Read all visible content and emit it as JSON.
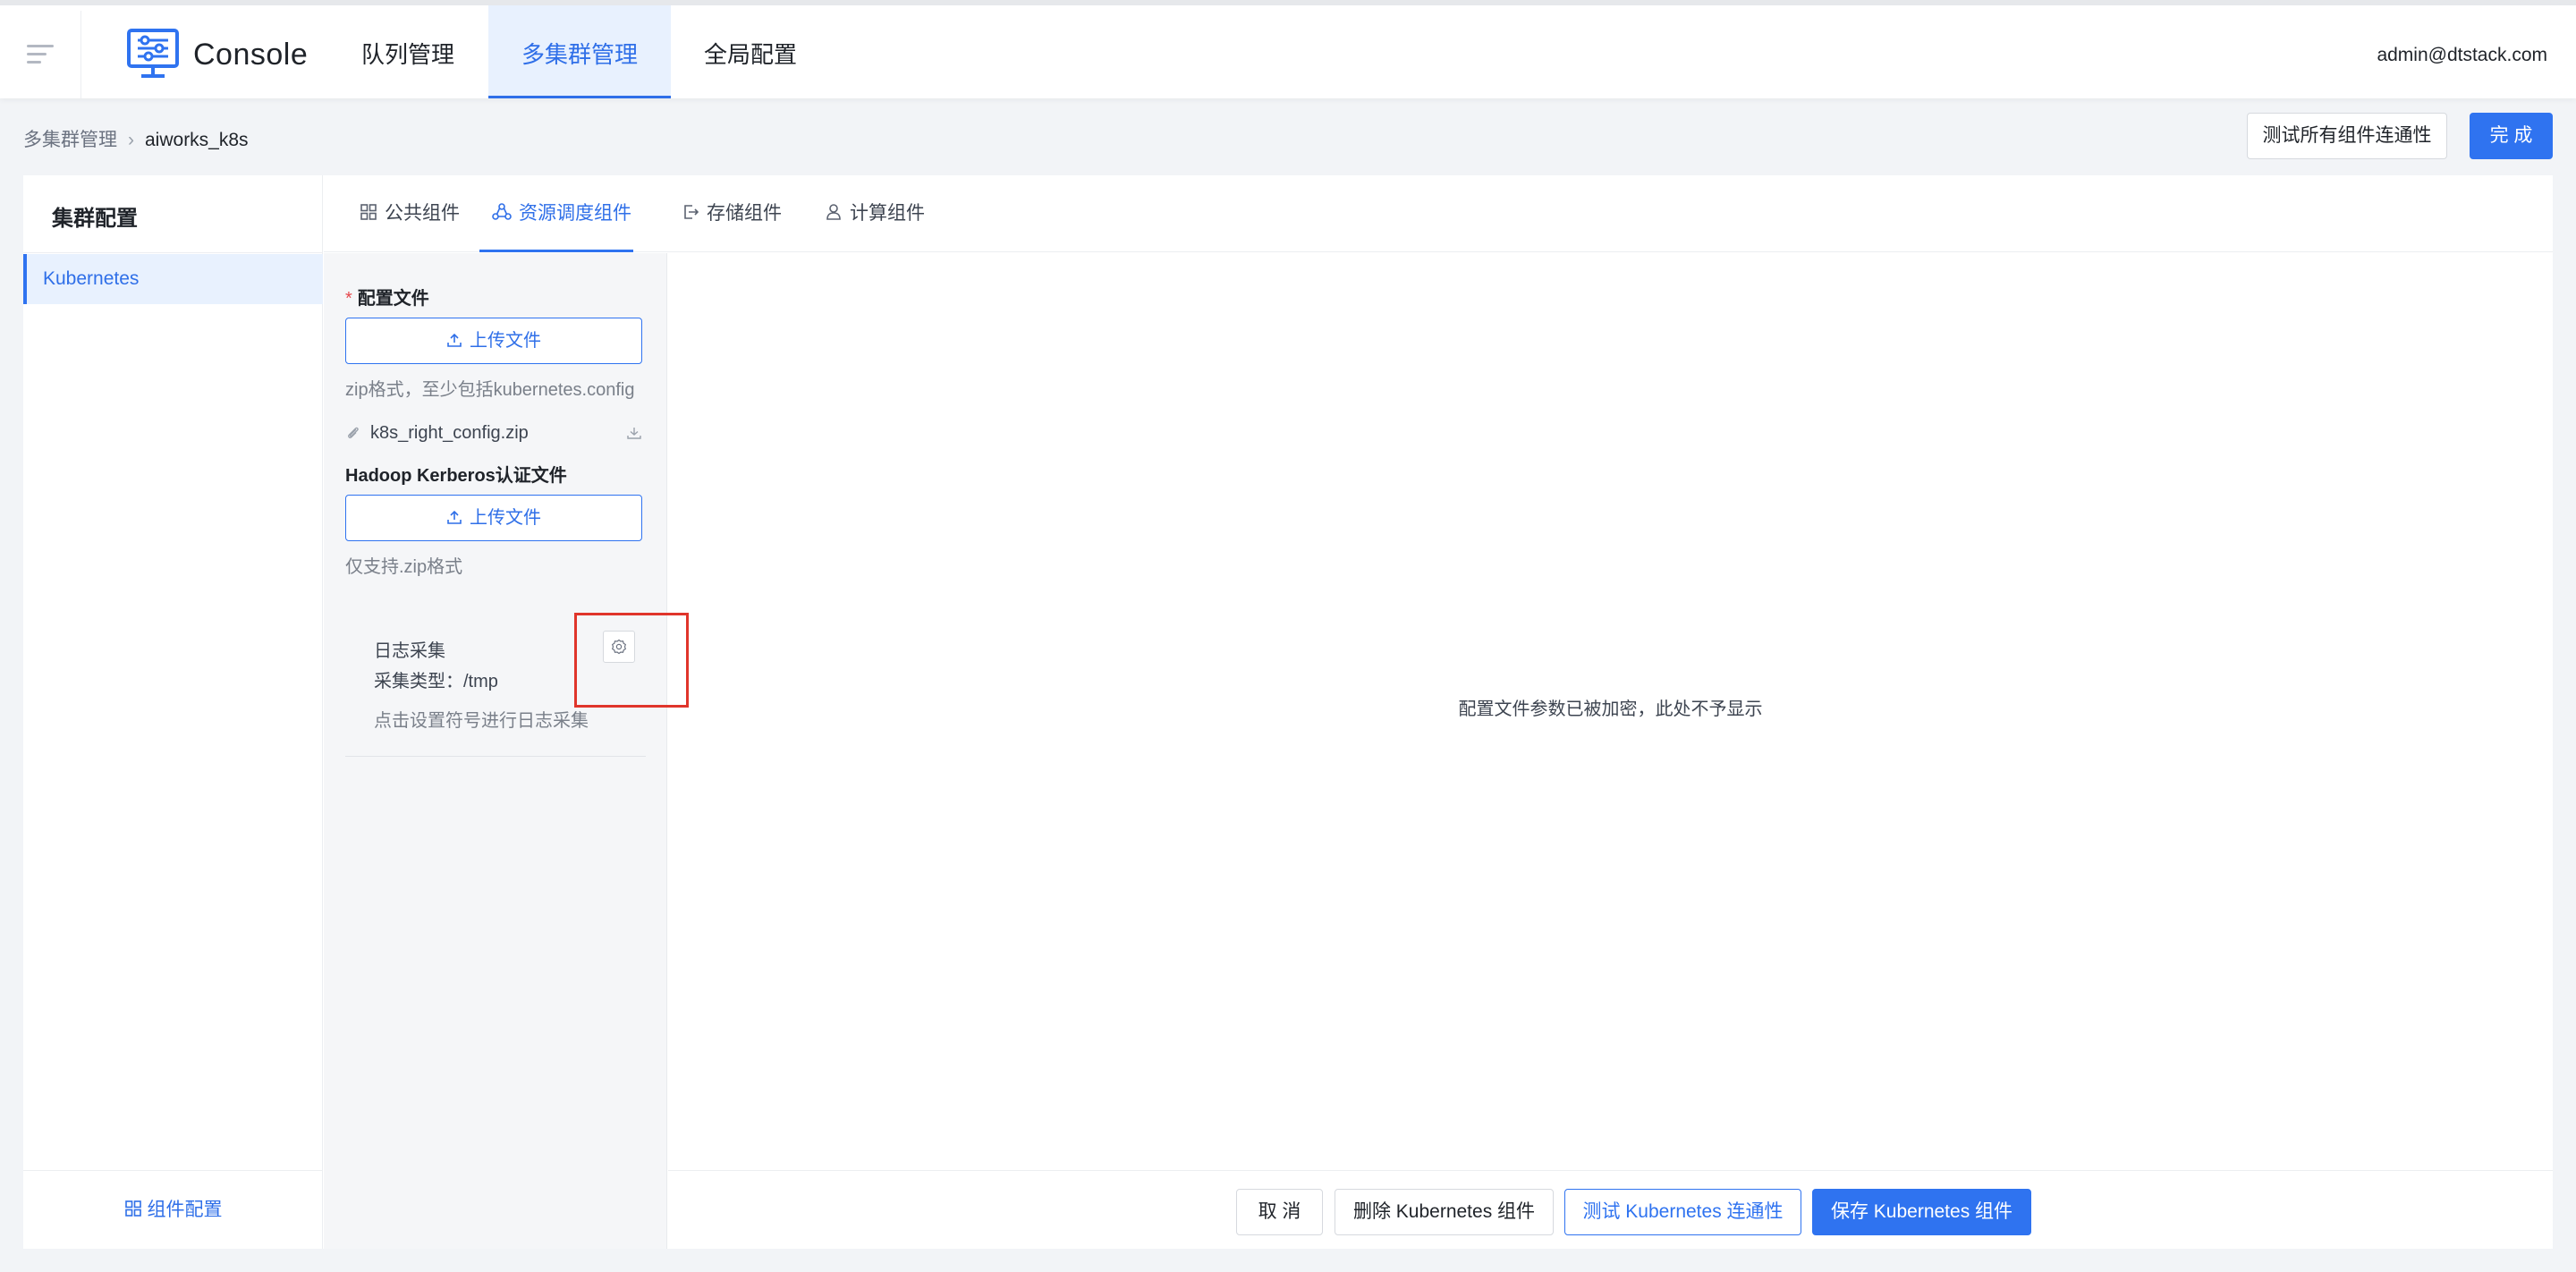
{
  "header": {
    "app_title": "Console",
    "nav": [
      {
        "label": "队列管理",
        "active": false
      },
      {
        "label": "多集群管理",
        "active": true
      },
      {
        "label": "全局配置",
        "active": false
      }
    ],
    "user_email": "admin@dtstack.com"
  },
  "breadcrumb": {
    "items": [
      "多集群管理",
      "aiworks_k8s"
    ]
  },
  "actions": {
    "test_all_label": "测试所有组件连通性",
    "done_label": "完 成"
  },
  "sidebar": {
    "title": "集群配置",
    "items": [
      {
        "label": "Kubernetes",
        "active": true
      }
    ],
    "footer_label": "组件配置"
  },
  "tabs": [
    {
      "label": "公共组件",
      "icon": "grid-icon",
      "active": false
    },
    {
      "label": "资源调度组件",
      "icon": "cluster-icon",
      "active": true
    },
    {
      "label": "存储组件",
      "icon": "storage-export-icon",
      "active": false
    },
    {
      "label": "计算组件",
      "icon": "user-icon",
      "active": false
    }
  ],
  "config": {
    "config_file_label": "配置文件",
    "required_mark": "*",
    "upload_label": "上传文件",
    "config_hint": "zip格式，至少包括kubernetes.config",
    "uploaded_file": "k8s_right_config.zip",
    "kerberos_label": "Hadoop Kerberos认证文件",
    "kerberos_upload_label": "上传文件",
    "kerberos_hint": "仅支持.zip格式",
    "log_title": "日志采集",
    "log_type": "采集类型：/tmp",
    "log_hint": "点击设置符号进行日志采集"
  },
  "editor": {
    "message": "配置文件参数已被加密，此处不予显示"
  },
  "footer": {
    "cancel_label": "取 消",
    "delete_label": "删除 Kubernetes 组件",
    "test_label": "测试 Kubernetes 连通性",
    "save_label": "保存 Kubernetes 组件"
  },
  "colors": {
    "primary": "#2f73f0",
    "highlight": "#e0352b"
  }
}
